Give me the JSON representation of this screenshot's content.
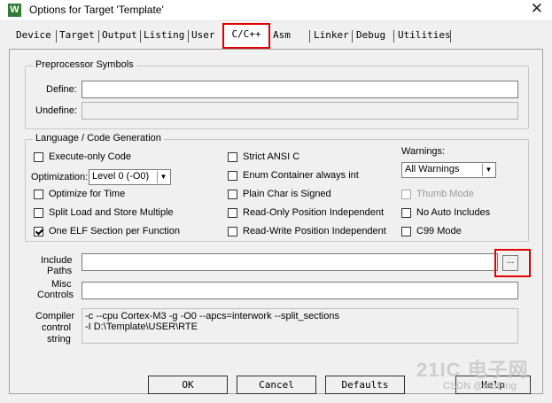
{
  "window": {
    "icon_letter": "W",
    "title": "Options for Target 'Template'",
    "close_glyph": "✕"
  },
  "tabs": [
    {
      "label": "Device"
    },
    {
      "label": "Target"
    },
    {
      "label": "Output"
    },
    {
      "label": "Listing"
    },
    {
      "label": "User"
    },
    {
      "label": "C/C++",
      "active": true
    },
    {
      "label": "Asm"
    },
    {
      "label": "Linker"
    },
    {
      "label": "Debug"
    },
    {
      "label": "Utilities"
    }
  ],
  "preprocessor": {
    "group_title": "Preprocessor Symbols",
    "define_label": "Define:",
    "define_value": "",
    "undefine_label": "Undefine:",
    "undefine_value": ""
  },
  "language": {
    "group_title": "Language / Code Generation",
    "execute_only": {
      "label": "Execute-only Code",
      "checked": false
    },
    "optimization_label": "Optimization:",
    "optimization_value": "Level 0 (-O0)",
    "optimize_for_time": {
      "label": "Optimize for Time",
      "checked": false
    },
    "split_load_store": {
      "label": "Split Load and Store Multiple",
      "checked": false
    },
    "one_elf_section": {
      "label": "One ELF Section per Function",
      "checked": true
    },
    "strict_ansi": {
      "label": "Strict ANSI C",
      "checked": false
    },
    "enum_container": {
      "label": "Enum Container always int",
      "checked": false
    },
    "plain_char_signed": {
      "label": "Plain Char is Signed",
      "checked": false
    },
    "ro_position_indep": {
      "label": "Read-Only Position Independent",
      "checked": false
    },
    "rw_position_indep": {
      "label": "Read-Write Position Independent",
      "checked": false
    },
    "warnings_label": "Warnings:",
    "warnings_value": "All Warnings",
    "thumb_mode": {
      "label": "Thumb Mode",
      "checked": false,
      "disabled": true
    },
    "no_auto_includes": {
      "label": "No Auto Includes",
      "checked": false
    },
    "c99_mode": {
      "label": "C99 Mode",
      "checked": false
    }
  },
  "paths": {
    "include_label_1": "Include",
    "include_label_2": "Paths",
    "include_value": "",
    "browse_label": "...",
    "misc_label_1": "Misc",
    "misc_label_2": "Controls",
    "misc_value": ""
  },
  "compiler": {
    "label_1": "Compiler",
    "label_2": "control",
    "label_3": "string",
    "line_1": "-c --cpu Cortex-M3 -g -O0 --apcs=interwork --split_sections",
    "line_2": "-I D:\\Template\\USER\\RTE"
  },
  "buttons": {
    "ok": "OK",
    "cancel": "Cancel",
    "defaults": "Defaults",
    "help": "Help"
  },
  "watermark": {
    "big": "21IC 电子网",
    "small": "CSDN @MbBing"
  },
  "colors": {
    "highlight": "#e00000",
    "dialog_bg": "#f0f0f0"
  }
}
